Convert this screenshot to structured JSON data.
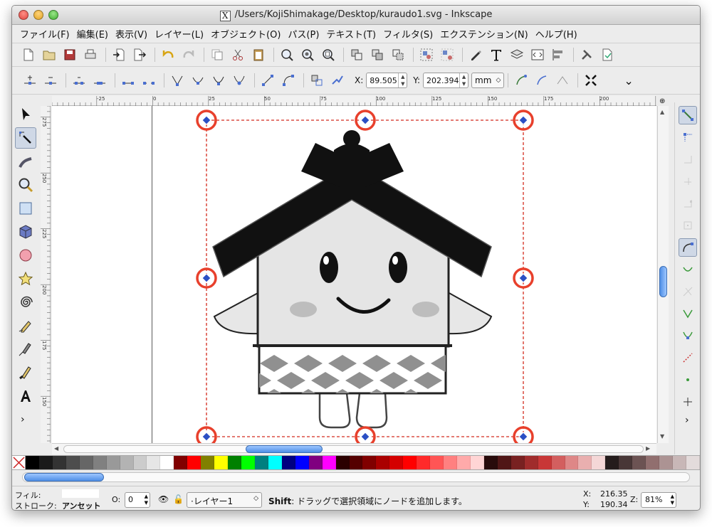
{
  "window": {
    "title": "/Users/KojiShimakage/Desktop/kuraudo1.svg - Inkscape",
    "x11_glyph": "X"
  },
  "menu": [
    "ファイル(F)",
    "編集(E)",
    "表示(V)",
    "レイヤー(L)",
    "オブジェクト(O)",
    "パス(P)",
    "テキスト(T)",
    "フィルタ(S)",
    "エクステンション(N)",
    "ヘルプ(H)"
  ],
  "controls": {
    "x_label": "X:",
    "x_value": "89.505",
    "y_label": "Y:",
    "y_value": "202.394",
    "unit": "mm",
    "more": "⌄"
  },
  "rulers": {
    "h_ticks": [
      "-25",
      "0",
      "25",
      "50",
      "75",
      "100",
      "125",
      "150",
      "175",
      "200"
    ],
    "v_ticks": [
      "275",
      "250",
      "225",
      "200",
      "175",
      "150"
    ]
  },
  "palette": [
    "#000000",
    "#1a1a1a",
    "#333333",
    "#4d4d4d",
    "#666666",
    "#808080",
    "#999999",
    "#b3b3b3",
    "#cccccc",
    "#e6e6e6",
    "#ffffff",
    "#800000",
    "#ff0000",
    "#808000",
    "#ffff00",
    "#008000",
    "#00ff00",
    "#008080",
    "#00ffff",
    "#000080",
    "#0000ff",
    "#800080",
    "#ff00ff",
    "#2b0000",
    "#550000",
    "#800000",
    "#aa0000",
    "#d40000",
    "#ff0000",
    "#ff2a2a",
    "#ff5555",
    "#ff8080",
    "#ffaaaa",
    "#ffd5d5",
    "#280b0b",
    "#501616",
    "#782121",
    "#a02c2c",
    "#c83737",
    "#d35f5f",
    "#de8787",
    "#e9afaf",
    "#f4d7d7",
    "#241c1c",
    "#483737",
    "#6c5353",
    "#916f6f",
    "#ac9393",
    "#c8b7b7",
    "#e3dbdb"
  ],
  "status": {
    "fill_label": "フィル:",
    "stroke_label": "ストローク:",
    "stroke_value": "アンセット",
    "opacity_label": "O:",
    "opacity_value": "0",
    "layer_name": "·レイヤー1",
    "message_key": "Shift",
    "message_rest": ": ドラッグで選択領域にノードを追加します。",
    "cursor_x_label": "X:",
    "cursor_x": "216.35",
    "cursor_y_label": "Y:",
    "cursor_y": "190.34",
    "zoom_label": "Z:",
    "zoom_value": "81%"
  },
  "colors": {
    "selection": "#d42b1e",
    "handle_ring": "#e8402c",
    "handle_diamond": "#2b4fc4",
    "accent_blue": "#4f8fe6"
  }
}
